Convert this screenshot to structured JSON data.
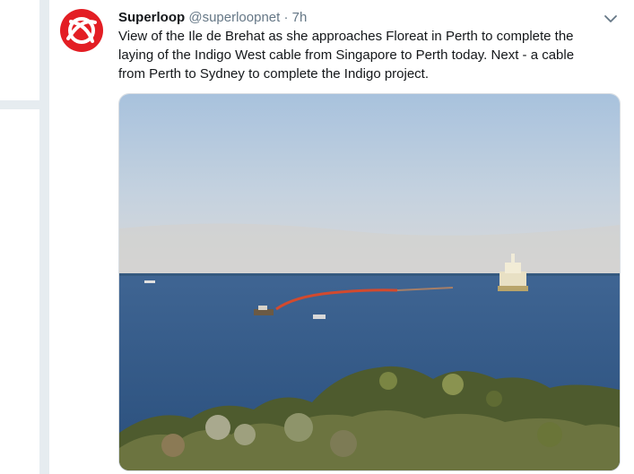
{
  "tweet": {
    "author_name": "Superloop",
    "author_handle": "@superloopnet",
    "separator": "·",
    "timestamp": "7h",
    "text_lines": [
      "View of the Ile de Brehat as she approaches Floreat in Perth to complete the",
      "laying of the Indigo West cable from Singapore to Perth today.  Next - a cable",
      "from Perth to Sydney to complete the Indigo project."
    ],
    "icons": {
      "avatar": "superloop-logo-icon",
      "menu": "chevron-down-icon"
    }
  },
  "colors": {
    "brand_red": "#e31e24",
    "page_bg": "#e6ecf0",
    "secondary_text": "#657786"
  }
}
